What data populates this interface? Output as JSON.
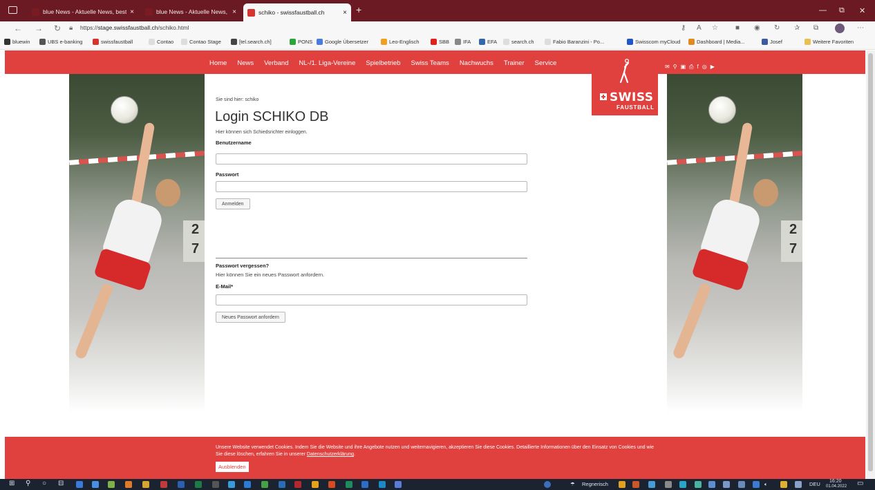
{
  "browser": {
    "tabs": [
      {
        "label": "blue News - Aktuelle News, best",
        "close": "×",
        "favicon_color": "#7a1a22"
      },
      {
        "label": "blue News - Aktuelle News, best",
        "close": "×",
        "favicon_color": "#7a1a22"
      },
      {
        "label": "schiko - swissfaustball.ch",
        "close": "×",
        "favicon_color": "#d6332f"
      }
    ],
    "new_tab": "+",
    "window_controls": [
      "—",
      "⧉",
      "✕"
    ],
    "url_prefix": "https://",
    "url_host": "stage.swissfaustball.ch",
    "url_path": "/schiko.html",
    "bookmarks": [
      {
        "label": "bluewin",
        "color": "#333333"
      },
      {
        "label": "UBS e-banking",
        "color": "#555555"
      },
      {
        "label": "swissfaustball",
        "color": "#d6332f"
      },
      {
        "label": "Contao",
        "color": "#dddddd"
      },
      {
        "label": "Contao Stage",
        "color": "#dddddd"
      },
      {
        "label": "[tel.search.ch]",
        "color": "#444444"
      },
      {
        "label": "PONS",
        "color": "#2aa53a"
      },
      {
        "label": "Google Übersetzer",
        "color": "#4a7be0"
      },
      {
        "label": "Leo-Englisch",
        "color": "#f0a020"
      },
      {
        "label": "SBB",
        "color": "#e0201a"
      },
      {
        "label": "IFA",
        "color": "#888888"
      },
      {
        "label": "EFA",
        "color": "#3366aa"
      },
      {
        "label": "search.ch",
        "color": "#dddddd"
      },
      {
        "label": "Fabio Baranzini - Po...",
        "color": "#dddddd"
      },
      {
        "label": "Swisscom myCloud",
        "color": "#2255cc"
      },
      {
        "label": "Dashboard | Media...",
        "color": "#e08a20"
      },
      {
        "label": "Josef",
        "color": "#3b5ba5"
      }
    ],
    "other_favorites": "Weitere Favoriten"
  },
  "site": {
    "menu": [
      "Home",
      "News",
      "Verband",
      "NL-/1. Liga-Vereine",
      "Spielbetrieb",
      "Swiss Teams",
      "Nachwuchs",
      "Trainer",
      "Service"
    ],
    "social_icons": [
      "mail-icon",
      "search-icon",
      "translate-icon",
      "print-icon",
      "facebook-icon",
      "instagram-icon",
      "youtube-icon"
    ],
    "social_glyphs": [
      "✉",
      "⚲",
      "▣",
      "⎙",
      "f",
      "◎",
      "▶"
    ],
    "logo_text": "SWISS",
    "logo_sub": "FAUSTBALL",
    "brand_color": "#e0403e",
    "photo_numbers": [
      "2",
      "7"
    ]
  },
  "login": {
    "breadcrumb": "Sie sind hier: schiko",
    "title": "Login SCHIKO DB",
    "intro": "Hier können sich Schiedsrichter einloggen.",
    "username_label": "Benutzername",
    "username_value": "",
    "password_label": "Passwort",
    "password_value": "",
    "submit_label": "Anmelden"
  },
  "forgot": {
    "heading": "Passwort vergessen?",
    "text": "Hier können Sie ein neues Passwort anfordern.",
    "email_label": "E-Mail*",
    "email_value": "",
    "submit_label": "Neues Passwort anfordern"
  },
  "cookie": {
    "message": "Unsere Website verwendet Cookies. Indem Sie die Website und ihre Angebote nutzen und weiternavigieren, akzeptieren Sie diese Cookies. Detaillierte Informationen über den Einsatz von Cookies und wie Sie diese löschen, erfahren Sie in unserer",
    "link": "Datenschutzerklärung",
    "end": ".",
    "button": "Ausblenden"
  },
  "taskbar": {
    "weather": "Regnerisch",
    "language": "DEU",
    "time": "16:20",
    "date": "01.04.2022"
  }
}
